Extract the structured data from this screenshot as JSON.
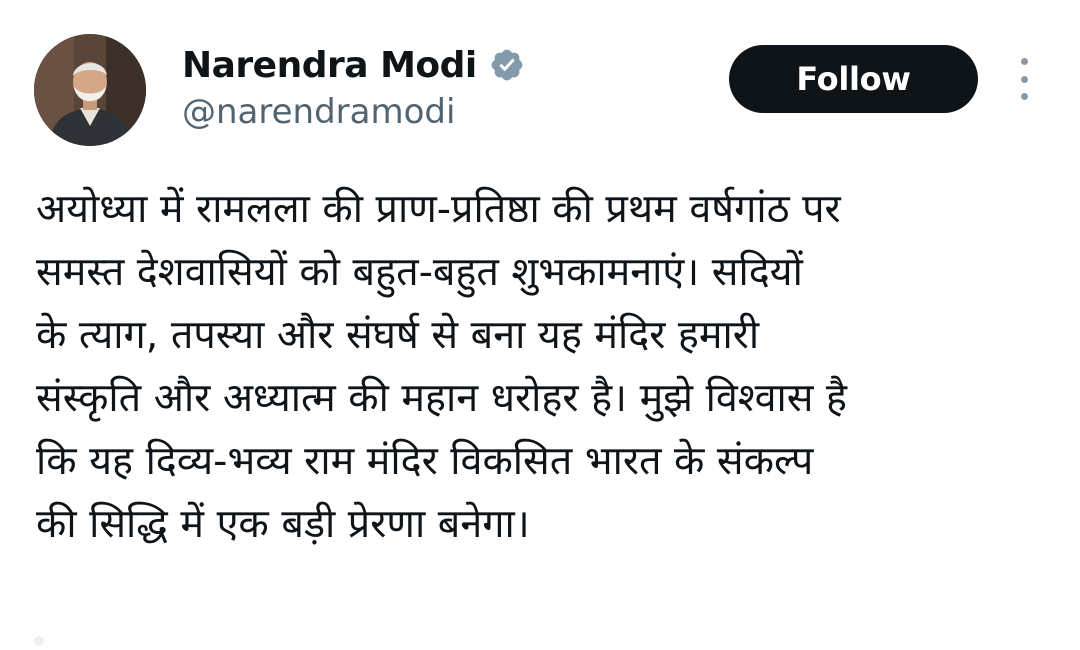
{
  "author": {
    "display_name": "Narendra Modi",
    "handle": "@narendramodi",
    "verified": true
  },
  "actions": {
    "follow_label": "Follow",
    "more_icon": "more-vertical-icon"
  },
  "tweet": {
    "lines": [
      "अयोध्या में रामलला की प्राण-प्रतिष्ठा की प्रथम वर्षगांठ पर",
      "समस्त देशवासियों को बहुत-बहुत शुभकामनाएं। सदियों",
      "के त्याग, तपस्या और संघर्ष से बना यह मंदिर हमारी",
      "संस्कृति और अध्यात्म की महान धरोहर है। मुझे विश्वास है",
      "कि यह दिव्य-भव्य राम मंदिर विकसित भारत के संकल्प",
      "की सिद्धि में एक बड़ी प्रेरणा बनेगा।"
    ]
  },
  "colors": {
    "text_primary": "#0f1419",
    "text_secondary": "#536471",
    "follow_button_bg": "#0f1419",
    "follow_button_text": "#ffffff",
    "verified_badge": "#829aab"
  }
}
